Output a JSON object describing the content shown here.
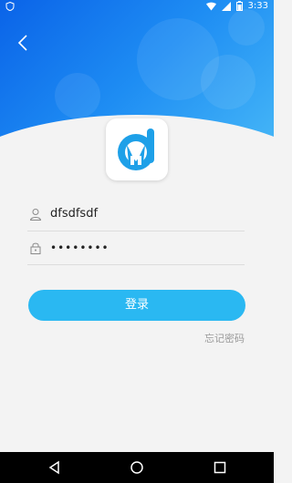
{
  "status_bar": {
    "time": "3:33"
  },
  "header": {
    "back_icon": "chevron-left-icon"
  },
  "app": {
    "logo_icon": "app-logo-icon"
  },
  "form": {
    "username": {
      "icon": "user-icon",
      "value": "dfsdfsdf"
    },
    "password": {
      "icon": "lock-icon",
      "value": "••••••••"
    }
  },
  "actions": {
    "login_label": "登录",
    "forgot_label": "忘记密码"
  },
  "colors": {
    "header_start": "#0a63e8",
    "header_end": "#46b7f7",
    "button": "#2ab8f2",
    "background": "#f3f3f3"
  },
  "nav_bar": {
    "back": "triangle-back-icon",
    "home": "circle-home-icon",
    "recents": "square-recents-icon"
  }
}
